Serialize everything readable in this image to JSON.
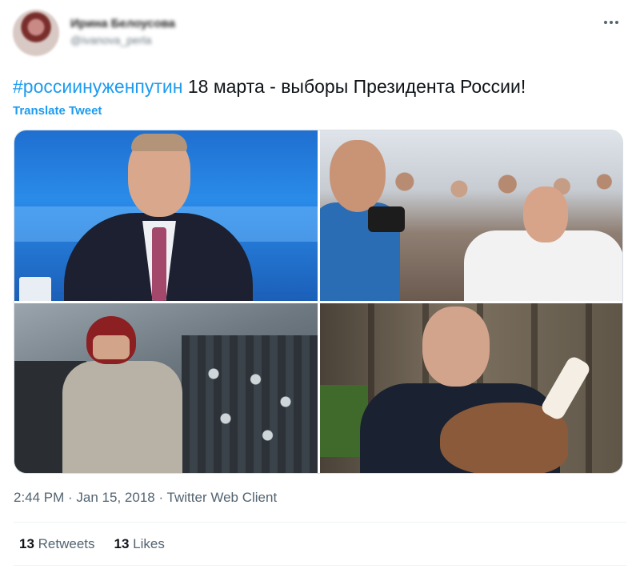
{
  "user": {
    "display_name": "Ирина Белоусова",
    "handle": "@ivanova_perla"
  },
  "tweet": {
    "hashtag": "#россиинуженпутин",
    "text_rest": " 18 марта - выборы Президента России!",
    "translate_label": "Translate Tweet"
  },
  "icons": {
    "more": "more-horizontal-icon"
  },
  "meta": {
    "time": "2:44 PM",
    "separator": " · ",
    "date": "Jan 15, 2018",
    "client": "Twitter Web Client"
  },
  "stats": {
    "retweets_count": "13",
    "retweets_label": " Retweets",
    "likes_count": "13",
    "likes_label": " Likes"
  },
  "colors": {
    "link": "#1d9bf0",
    "text": "#0f1419",
    "secondary": "#536471"
  }
}
